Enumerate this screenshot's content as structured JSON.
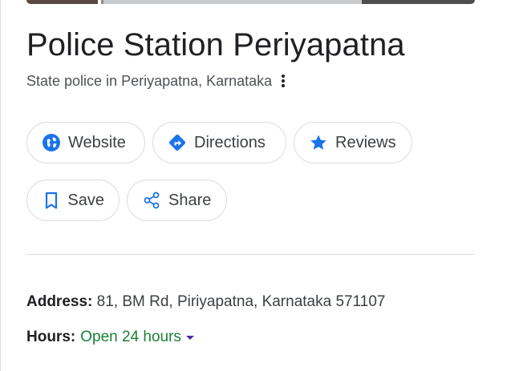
{
  "place": {
    "title": "Police Station Periyapatna",
    "subtitle": "State police in Periyapatna, Karnataka"
  },
  "actions": {
    "website": {
      "label": "Website",
      "icon": "globe-icon"
    },
    "directions": {
      "label": "Directions",
      "icon": "directions-icon"
    },
    "reviews": {
      "label": "Reviews",
      "icon": "star-icon"
    },
    "save": {
      "label": "Save",
      "icon": "bookmark-icon"
    },
    "share": {
      "label": "Share",
      "icon": "share-icon"
    }
  },
  "info": {
    "address_label": "Address:",
    "address_value": "81, BM Rd, Piriyapatna, Karnataka 571107",
    "hours_label": "Hours:",
    "hours_value": "Open 24 hours"
  },
  "colors": {
    "accent": "#1a73e8",
    "open_status": "#188038",
    "chip_border": "#dadce0"
  }
}
